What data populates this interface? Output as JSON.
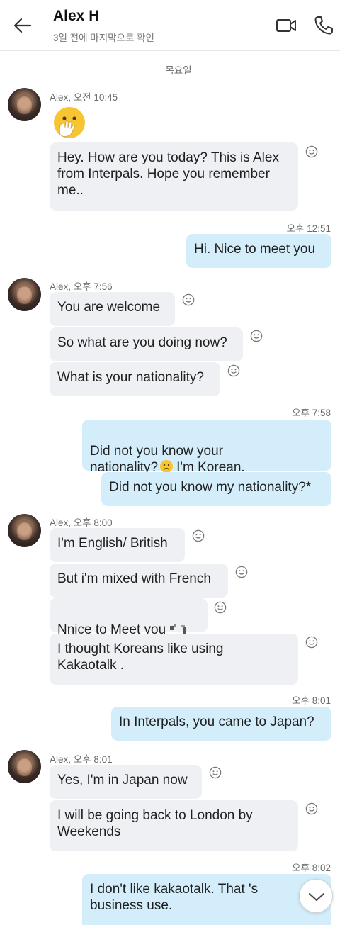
{
  "header": {
    "contact_name": "Alex H",
    "last_seen": "3일 전에 마지막으로 확인"
  },
  "day_divider": "목요일",
  "colors": {
    "outgoing_bubble": "#d3edfb",
    "incoming_bubble": "#eef0f3"
  },
  "groups": [
    {
      "sender_line": "Alex, 오전 10:45",
      "messages": [
        "Hey. How are you today? This is Alex from Interpals. Hope you remember me.."
      ]
    },
    {
      "time": "오후 12:51",
      "messages": [
        "Hi. Nice to meet you"
      ]
    },
    {
      "sender_line": "Alex, 오후 7:56",
      "messages": [
        "You are welcome",
        "So what are you doing now?",
        "What is your nationality?"
      ]
    },
    {
      "time": "오후 7:58",
      "messages": [
        "Did not you know your\nnationality?",
        "I'm Korean.",
        "Did not you know my nationality?*"
      ]
    },
    {
      "sender_line": "Alex, 오후 8:00",
      "messages": [
        "I'm English/ British",
        "But i'm mixed with French",
        "Nnice to Meet you",
        "I thought Koreans like using\nKakaotalk ."
      ]
    },
    {
      "time": "오후 8:01",
      "messages": [
        "In Interpals, you came to Japan?"
      ]
    },
    {
      "sender_line": "Alex, 오후 8:01",
      "messages": [
        "Yes, I'm in Japan now",
        "I will be going back to London by\nWeekends"
      ]
    },
    {
      "time": "오후 8:02",
      "messages": [
        "I don't like kakaotalk. That 's\nbusiness use."
      ]
    }
  ],
  "icons": [
    "back-arrow-icon",
    "video-call-icon",
    "phone-icon",
    "emoji-reaction-icon",
    "scroll-down-icon"
  ]
}
